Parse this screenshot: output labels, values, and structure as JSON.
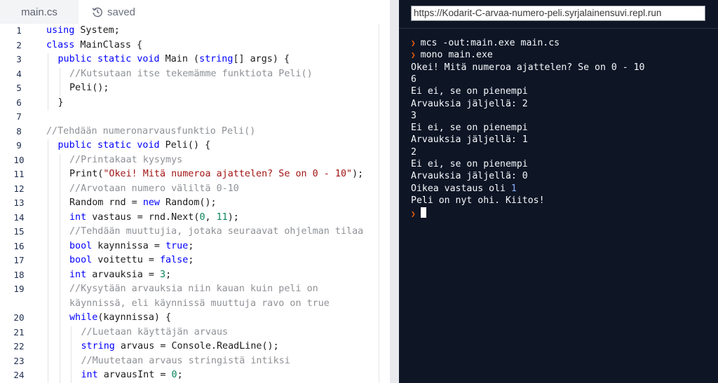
{
  "editor": {
    "tab_file": "main.cs",
    "tab_status": "saved",
    "lines": [
      {
        "n": "1",
        "indent": 0,
        "tokens": [
          {
            "t": "kw",
            "v": "using"
          },
          {
            "t": "tx",
            "v": " System;"
          }
        ]
      },
      {
        "n": "2",
        "indent": 0,
        "tokens": [
          {
            "t": "kw",
            "v": "class"
          },
          {
            "t": "tx",
            "v": " MainClass {"
          }
        ]
      },
      {
        "n": "3",
        "indent": 1,
        "tokens": [
          {
            "t": "kw",
            "v": "public"
          },
          {
            "t": "tx",
            "v": " "
          },
          {
            "t": "kw",
            "v": "static"
          },
          {
            "t": "tx",
            "v": " "
          },
          {
            "t": "kw",
            "v": "void"
          },
          {
            "t": "tx",
            "v": " Main ("
          },
          {
            "t": "kw",
            "v": "string"
          },
          {
            "t": "tx",
            "v": "[] args) {"
          }
        ]
      },
      {
        "n": "4",
        "indent": 2,
        "tokens": [
          {
            "t": "cm",
            "v": "//Kutsutaan itse tekemämme funktiota Peli()"
          }
        ]
      },
      {
        "n": "5",
        "indent": 2,
        "tokens": [
          {
            "t": "tx",
            "v": "Peli();"
          }
        ]
      },
      {
        "n": "6",
        "indent": 1,
        "tokens": [
          {
            "t": "tx",
            "v": "}"
          }
        ]
      },
      {
        "n": "7",
        "indent": 0,
        "tokens": []
      },
      {
        "n": "8",
        "indent": 0,
        "tokens": [
          {
            "t": "cm",
            "v": "//Tehdään numeronarvausfunktio Peli()"
          }
        ]
      },
      {
        "n": "9",
        "indent": 1,
        "tokens": [
          {
            "t": "kw",
            "v": "public"
          },
          {
            "t": "tx",
            "v": " "
          },
          {
            "t": "kw",
            "v": "static"
          },
          {
            "t": "tx",
            "v": " "
          },
          {
            "t": "kw",
            "v": "void"
          },
          {
            "t": "tx",
            "v": " Peli() {"
          }
        ]
      },
      {
        "n": "10",
        "indent": 2,
        "tokens": [
          {
            "t": "cm",
            "v": "//Printakaat kysymys"
          }
        ]
      },
      {
        "n": "11",
        "indent": 2,
        "tokens": [
          {
            "t": "tx",
            "v": "Print("
          },
          {
            "t": "st",
            "v": "\"Okei! Mitä numeroa ajattelen? Se on 0 - 10\""
          },
          {
            "t": "tx",
            "v": ");"
          }
        ]
      },
      {
        "n": "12",
        "indent": 2,
        "tokens": [
          {
            "t": "cm",
            "v": "//Arvotaan numero väliltä 0-10"
          }
        ]
      },
      {
        "n": "13",
        "indent": 2,
        "tokens": [
          {
            "t": "tx",
            "v": "Random rnd = "
          },
          {
            "t": "kw",
            "v": "new"
          },
          {
            "t": "tx",
            "v": " Random();"
          }
        ]
      },
      {
        "n": "14",
        "indent": 2,
        "tokens": [
          {
            "t": "kw",
            "v": "int"
          },
          {
            "t": "tx",
            "v": " vastaus = rnd.Next("
          },
          {
            "t": "nm",
            "v": "0"
          },
          {
            "t": "tx",
            "v": ", "
          },
          {
            "t": "nm",
            "v": "11"
          },
          {
            "t": "tx",
            "v": ");"
          }
        ]
      },
      {
        "n": "15",
        "indent": 2,
        "tokens": [
          {
            "t": "cm",
            "v": "//Tehdään muuttujia, jotaka seuraavat ohjelman tilaa"
          }
        ]
      },
      {
        "n": "16",
        "indent": 2,
        "tokens": [
          {
            "t": "kw",
            "v": "bool"
          },
          {
            "t": "tx",
            "v": " kaynnissa = "
          },
          {
            "t": "kw",
            "v": "true"
          },
          {
            "t": "tx",
            "v": ";"
          }
        ]
      },
      {
        "n": "17",
        "indent": 2,
        "tokens": [
          {
            "t": "kw",
            "v": "bool"
          },
          {
            "t": "tx",
            "v": " voitettu = "
          },
          {
            "t": "kw",
            "v": "false"
          },
          {
            "t": "tx",
            "v": ";"
          }
        ]
      },
      {
        "n": "18",
        "indent": 2,
        "tokens": [
          {
            "t": "kw",
            "v": "int"
          },
          {
            "t": "tx",
            "v": " arvauksia = "
          },
          {
            "t": "nm",
            "v": "3"
          },
          {
            "t": "tx",
            "v": ";"
          }
        ]
      },
      {
        "n": "19",
        "indent": 2,
        "tokens": [
          {
            "t": "cm",
            "v": "//Kysytään arvauksia niin kauan kuin peli on"
          }
        ]
      },
      {
        "n": "",
        "indent": 2,
        "tokens": [
          {
            "t": "cm",
            "v": "käynnissä, eli käynnissä muuttuja ravo on true"
          }
        ]
      },
      {
        "n": "20",
        "indent": 2,
        "tokens": [
          {
            "t": "kw",
            "v": "while"
          },
          {
            "t": "tx",
            "v": "(kaynnissa) {"
          }
        ]
      },
      {
        "n": "21",
        "indent": 3,
        "tokens": [
          {
            "t": "cm",
            "v": "//Luetaan käyttäjän arvaus"
          }
        ]
      },
      {
        "n": "22",
        "indent": 3,
        "tokens": [
          {
            "t": "kw",
            "v": "string"
          },
          {
            "t": "tx",
            "v": " arvaus = Console.ReadLine();"
          }
        ]
      },
      {
        "n": "23",
        "indent": 3,
        "tokens": [
          {
            "t": "cm",
            "v": "//Muutetaan arvaus stringistä intiksi"
          }
        ]
      },
      {
        "n": "24",
        "indent": 3,
        "tokens": [
          {
            "t": "kw",
            "v": "int"
          },
          {
            "t": "tx",
            "v": " arvausInt = "
          },
          {
            "t": "nm",
            "v": "0"
          },
          {
            "t": "tx",
            "v": ";"
          }
        ]
      }
    ]
  },
  "terminal": {
    "url": "https://Kodarit-C-arvaa-numero-peli.syrjalainensuvi.repl.run",
    "prompt_symbol": "❯",
    "lines": [
      {
        "kind": "cmd",
        "text": "mcs -out:main.exe main.cs"
      },
      {
        "kind": "cmd",
        "text": "mono main.exe"
      },
      {
        "kind": "out",
        "text": "Okei! Mitä numeroa ajattelen? Se on 0 - 10"
      },
      {
        "kind": "out",
        "text": "6"
      },
      {
        "kind": "out",
        "text": "Ei ei, se on pienempi"
      },
      {
        "kind": "out",
        "text": "Arvauksia jäljellä: 2"
      },
      {
        "kind": "out",
        "text": "3"
      },
      {
        "kind": "out",
        "text": "Ei ei, se on pienempi"
      },
      {
        "kind": "out",
        "text": "Arvauksia jäljellä: 1"
      },
      {
        "kind": "out",
        "text": "2"
      },
      {
        "kind": "out",
        "text": "Ei ei, se on pienempi"
      },
      {
        "kind": "out",
        "text": "Arvauksia jäljellä: 0"
      },
      {
        "kind": "outnum",
        "text": "Oikea vastaus oli ",
        "num": "1"
      },
      {
        "kind": "out",
        "text": "Peli on nyt ohi. Kiitos!"
      },
      {
        "kind": "cursor",
        "text": ""
      }
    ]
  }
}
